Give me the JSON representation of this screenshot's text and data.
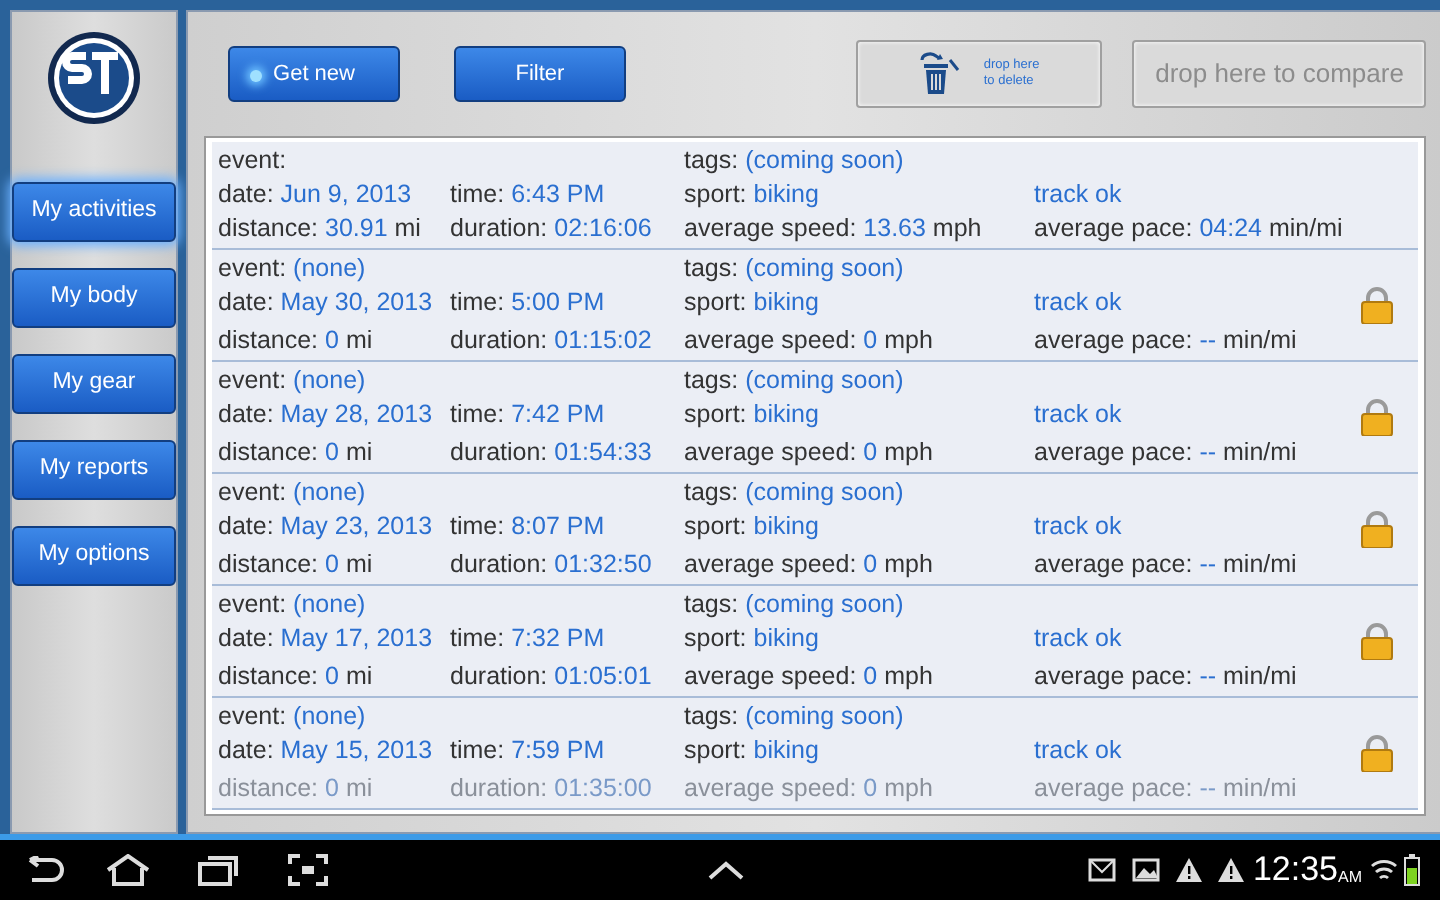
{
  "sidebar": {
    "items": [
      {
        "label": "My activities",
        "selected": true
      },
      {
        "label": "My body",
        "selected": false
      },
      {
        "label": "My gear",
        "selected": false
      },
      {
        "label": "My reports",
        "selected": false
      },
      {
        "label": "My options",
        "selected": false
      }
    ]
  },
  "toolbar": {
    "buttons": [
      {
        "label": "Get new",
        "indicator": true
      },
      {
        "label": "Filter",
        "indicator": false
      }
    ],
    "delete_zone": {
      "line_1": "drop here",
      "line_2": "to delete"
    },
    "compare_zone": {
      "label": "drop here to compare"
    }
  },
  "activities": [
    {
      "locked": false,
      "faded_last_line": false,
      "fields": [
        {
          "label": "event:"
        },
        {
          "label": "tags:",
          "value": "(coming soon)"
        },
        {
          "label": "date:",
          "value": "Jun 9, 2013"
        },
        {
          "label": "time:",
          "value": "6:43 PM"
        },
        {
          "label": "sport:",
          "value": "biking"
        },
        {
          "value": "track ok"
        },
        {
          "label": "distance:",
          "value": "30.91",
          "unit": "mi"
        },
        {
          "label": "duration:",
          "value": "02:16:06"
        },
        {
          "label": "average speed:",
          "value": "13.63",
          "unit": "mph"
        },
        {
          "label": "average pace:",
          "value": "04:24",
          "unit": "min/mi"
        }
      ]
    },
    {
      "locked": true,
      "faded_last_line": false,
      "fields": [
        {
          "label": "event:",
          "value": "(none)"
        },
        {
          "label": "tags:",
          "value": "(coming soon)"
        },
        {
          "label": "date:",
          "value": "May 30, 2013"
        },
        {
          "label": "time:",
          "value": "5:00 PM"
        },
        {
          "label": "sport:",
          "value": "biking"
        },
        {
          "value": "track ok"
        },
        {
          "label": "distance:",
          "value": "0",
          "unit": "mi"
        },
        {
          "label": "duration:",
          "value": "01:15:02"
        },
        {
          "label": "average speed:",
          "value": "0",
          "unit": "mph"
        },
        {
          "label": "average pace:",
          "value": "--",
          "unit": "min/mi"
        }
      ]
    },
    {
      "locked": true,
      "faded_last_line": false,
      "fields": [
        {
          "label": "event:",
          "value": "(none)"
        },
        {
          "label": "tags:",
          "value": "(coming soon)"
        },
        {
          "label": "date:",
          "value": "May 28, 2013"
        },
        {
          "label": "time:",
          "value": "7:42 PM"
        },
        {
          "label": "sport:",
          "value": "biking"
        },
        {
          "value": "track ok"
        },
        {
          "label": "distance:",
          "value": "0",
          "unit": "mi"
        },
        {
          "label": "duration:",
          "value": "01:54:33"
        },
        {
          "label": "average speed:",
          "value": "0",
          "unit": "mph"
        },
        {
          "label": "average pace:",
          "value": "--",
          "unit": "min/mi"
        }
      ]
    },
    {
      "locked": true,
      "faded_last_line": false,
      "fields": [
        {
          "label": "event:",
          "value": "(none)"
        },
        {
          "label": "tags:",
          "value": "(coming soon)"
        },
        {
          "label": "date:",
          "value": "May 23, 2013"
        },
        {
          "label": "time:",
          "value": "8:07 PM"
        },
        {
          "label": "sport:",
          "value": "biking"
        },
        {
          "value": "track ok"
        },
        {
          "label": "distance:",
          "value": "0",
          "unit": "mi"
        },
        {
          "label": "duration:",
          "value": "01:32:50"
        },
        {
          "label": "average speed:",
          "value": "0",
          "unit": "mph"
        },
        {
          "label": "average pace:",
          "value": "--",
          "unit": "min/mi"
        }
      ]
    },
    {
      "locked": true,
      "faded_last_line": false,
      "fields": [
        {
          "label": "event:",
          "value": "(none)"
        },
        {
          "label": "tags:",
          "value": "(coming soon)"
        },
        {
          "label": "date:",
          "value": "May 17, 2013"
        },
        {
          "label": "time:",
          "value": "7:32 PM"
        },
        {
          "label": "sport:",
          "value": "biking"
        },
        {
          "value": "track ok"
        },
        {
          "label": "distance:",
          "value": "0",
          "unit": "mi"
        },
        {
          "label": "duration:",
          "value": "01:05:01"
        },
        {
          "label": "average speed:",
          "value": "0",
          "unit": "mph"
        },
        {
          "label": "average pace:",
          "value": "--",
          "unit": "min/mi"
        }
      ]
    },
    {
      "locked": true,
      "faded_last_line": true,
      "fields": [
        {
          "label": "event:",
          "value": "(none)"
        },
        {
          "label": "tags:",
          "value": "(coming soon)"
        },
        {
          "label": "date:",
          "value": "May 15, 2013"
        },
        {
          "label": "time:",
          "value": "7:59 PM"
        },
        {
          "label": "sport:",
          "value": "biking"
        },
        {
          "value": "track ok"
        },
        {
          "label": "distance:",
          "value": "0",
          "unit": "mi"
        },
        {
          "label": "duration:",
          "value": "01:35:00"
        },
        {
          "label": "average speed:",
          "value": "0",
          "unit": "mph"
        },
        {
          "label": "average pace:",
          "value": "--",
          "unit": "min/mi"
        }
      ]
    }
  ],
  "status_bar": {
    "time": "12:35",
    "ampm": "AM"
  }
}
